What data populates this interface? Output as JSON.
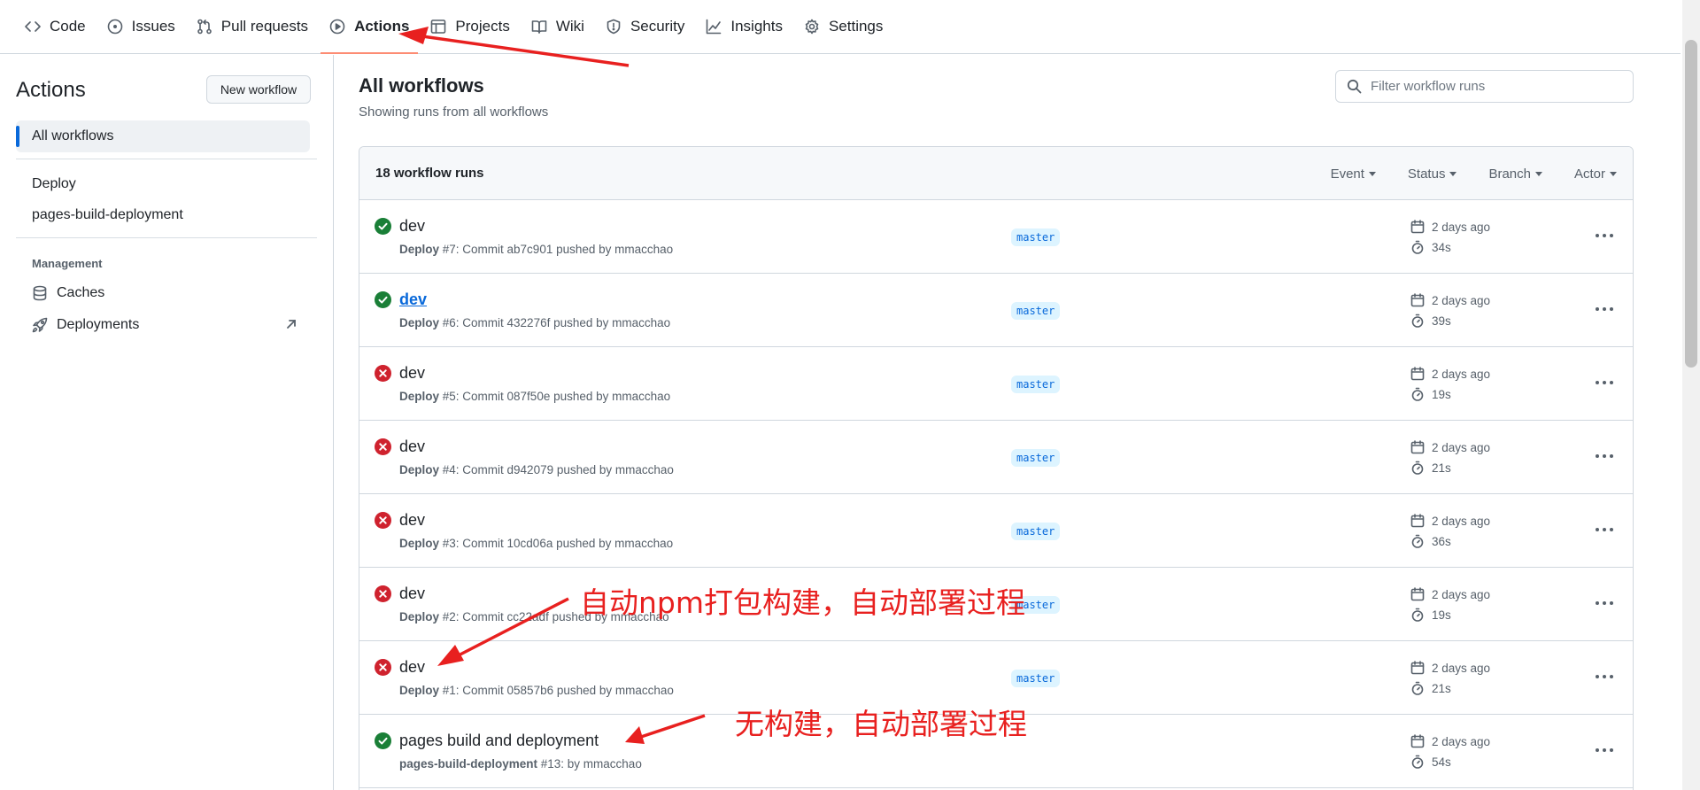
{
  "nav": {
    "tabs": [
      {
        "label": "Code",
        "icon": "code-icon"
      },
      {
        "label": "Issues",
        "icon": "issue-opened-icon"
      },
      {
        "label": "Pull requests",
        "icon": "git-pull-request-icon"
      },
      {
        "label": "Actions",
        "icon": "play-icon"
      },
      {
        "label": "Projects",
        "icon": "table-icon"
      },
      {
        "label": "Wiki",
        "icon": "book-icon"
      },
      {
        "label": "Security",
        "icon": "shield-icon"
      },
      {
        "label": "Insights",
        "icon": "graph-icon"
      },
      {
        "label": "Settings",
        "icon": "gear-icon"
      }
    ],
    "selected_index": 3
  },
  "sidebar": {
    "title": "Actions",
    "new_workflow_label": "New workflow",
    "all_workflows_label": "All workflows",
    "workflows": [
      "Deploy",
      "pages-build-deployment"
    ],
    "management_heading": "Management",
    "caches_label": "Caches",
    "deployments_label": "Deployments"
  },
  "main": {
    "title": "All workflows",
    "subtitle": "Showing runs from all workflows",
    "filter_placeholder": "Filter workflow runs",
    "run_count_label": "18 workflow runs",
    "filters": [
      "Event",
      "Status",
      "Branch",
      "Actor"
    ]
  },
  "runs": [
    {
      "title": "dev",
      "status": "success",
      "workflow": "Deploy",
      "meta": " #7: Commit ab7c901 pushed by mmacchao",
      "branch": "master",
      "time": "2 days ago",
      "duration": "34s",
      "link": false
    },
    {
      "title": "dev",
      "status": "success",
      "workflow": "Deploy",
      "meta": " #6: Commit 432276f pushed by mmacchao",
      "branch": "master",
      "time": "2 days ago",
      "duration": "39s",
      "link": true
    },
    {
      "title": "dev",
      "status": "failure",
      "workflow": "Deploy",
      "meta": " #5: Commit 087f50e pushed by mmacchao",
      "branch": "master",
      "time": "2 days ago",
      "duration": "19s",
      "link": false
    },
    {
      "title": "dev",
      "status": "failure",
      "workflow": "Deploy",
      "meta": " #4: Commit d942079 pushed by mmacchao",
      "branch": "master",
      "time": "2 days ago",
      "duration": "21s",
      "link": false
    },
    {
      "title": "dev",
      "status": "failure",
      "workflow": "Deploy",
      "meta": " #3: Commit 10cd06a pushed by mmacchao",
      "branch": "master",
      "time": "2 days ago",
      "duration": "36s",
      "link": false
    },
    {
      "title": "dev",
      "status": "failure",
      "workflow": "Deploy",
      "meta": " #2: Commit cc22adf pushed by mmacchao",
      "branch": "master",
      "time": "2 days ago",
      "duration": "19s",
      "link": false
    },
    {
      "title": "dev",
      "status": "failure",
      "workflow": "Deploy",
      "meta": " #1: Commit 05857b6 pushed by mmacchao",
      "branch": "master",
      "time": "2 days ago",
      "duration": "21s",
      "link": false
    },
    {
      "title": "pages build and deployment",
      "status": "success",
      "workflow": "pages-build-deployment",
      "meta": " #13: by mmacchao",
      "branch": "",
      "time": "2 days ago",
      "duration": "54s",
      "link": false
    }
  ],
  "annotations": {
    "note1": "自动npm打包构建，自动部署过程",
    "note2": "无构建，自动部署过程"
  },
  "colors": {
    "success": "#1a7f37",
    "failure": "#cf222e",
    "accent": "#0969da",
    "annotation": "#e8201f"
  }
}
